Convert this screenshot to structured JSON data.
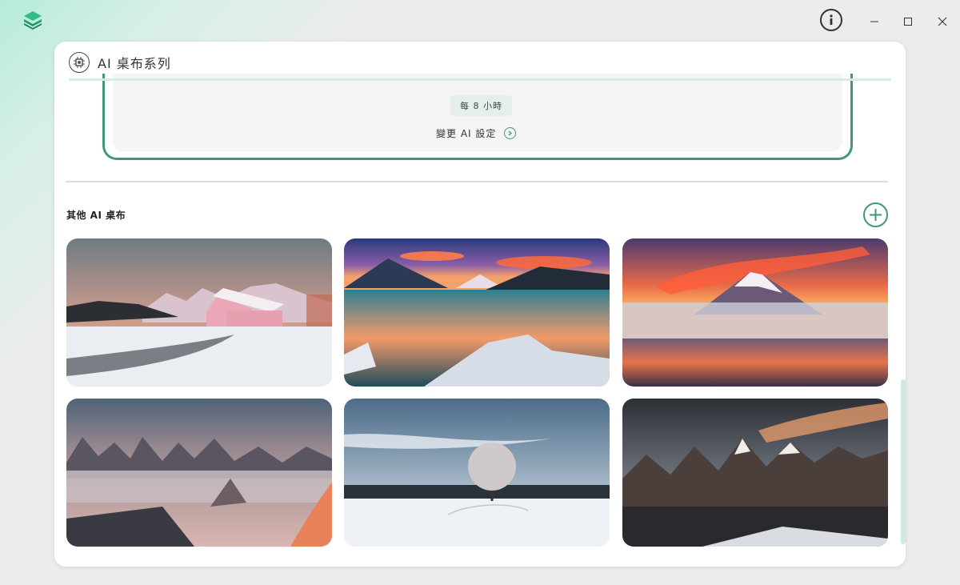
{
  "window": {
    "logo_icon": "stack-layers-icon",
    "info_icon": "info-icon",
    "minimize_icon": "minimize-icon",
    "maximize_icon": "maximize-icon",
    "close_icon": "close-icon"
  },
  "panel": {
    "title": "AI 桌布系列",
    "title_icon": "chip-icon"
  },
  "current_series": {
    "frequency": "每 8 小時",
    "change_settings": "變更 AI 設定"
  },
  "other_series": {
    "title": "其他 AI 桌布",
    "add_icon": "plus-circle-icon",
    "thumbnails": [
      {
        "scene": "snowy-pink-cabin"
      },
      {
        "scene": "sunset-mountain-lake"
      },
      {
        "scene": "snow-volcano-sunset"
      },
      {
        "scene": "misty-peaks-dawn"
      },
      {
        "scene": "lone-snow-tree"
      },
      {
        "scene": "jagged-snow-peaks"
      }
    ]
  },
  "colors": {
    "accent": "#3f9a74",
    "accent_light": "#e3efe8"
  }
}
